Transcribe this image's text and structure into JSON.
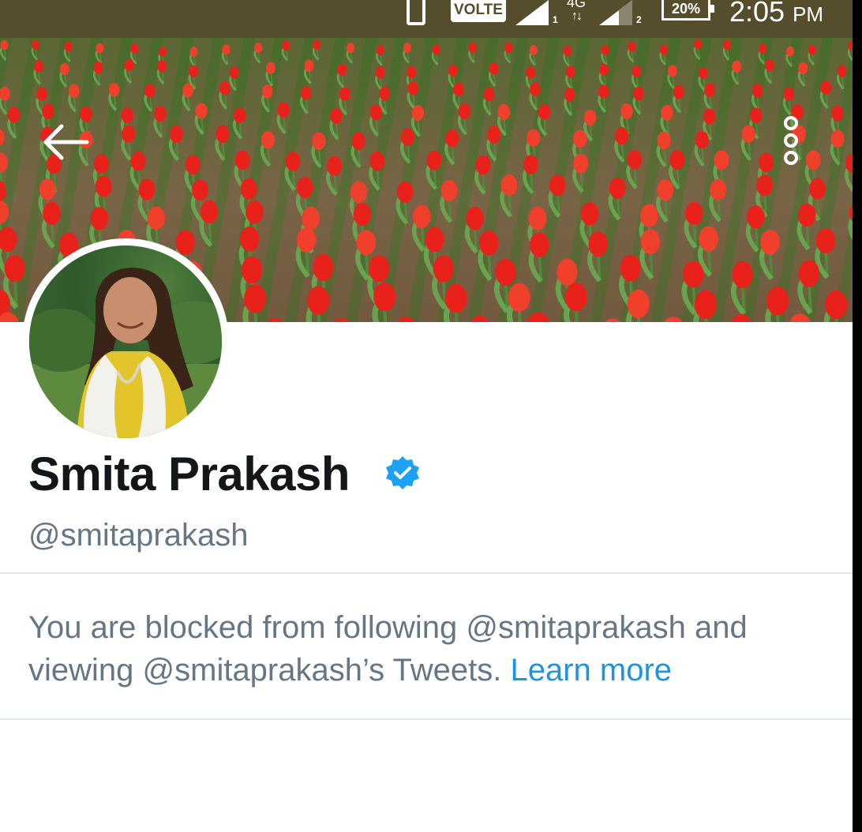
{
  "status_bar": {
    "volte_label": "VOLTE",
    "network_type": "4G",
    "network_arrows": "↑↓",
    "sim1_label": "1",
    "sim2_label": "2",
    "battery_percent": "20%",
    "time": "2:05",
    "time_suffix": "PM"
  },
  "header": {
    "back_icon": "arrow-left-icon",
    "more_icon": "more-vertical-icon"
  },
  "profile": {
    "display_name": "Smita Prakash",
    "verified_icon": "verified-badge-icon",
    "handle": "@smitaprakash",
    "blocked_message": "You are blocked from following @smitaprakash and viewing @smitaprakash’s Tweets.",
    "learn_more_label": "Learn more"
  },
  "colors": {
    "status_bar_bg": "#564d2c",
    "link": "#1b95e0",
    "verified": "#1da1f2",
    "secondary_text": "#657786",
    "primary_text": "#14171a"
  }
}
